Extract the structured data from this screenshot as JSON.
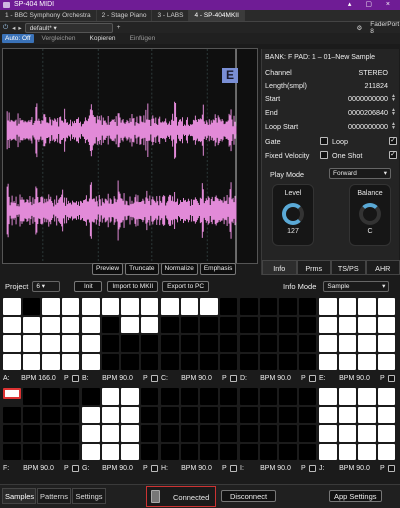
{
  "window": {
    "title": "SP-404 MIDI",
    "controls": "▴ ▢ ×"
  },
  "tabs": [
    {
      "label": "1 - BBC Symphony Orchestra",
      "active": false
    },
    {
      "label": "2 - Stage Piano",
      "active": false
    },
    {
      "label": "3 - LABS",
      "active": false
    },
    {
      "label": "4 - SP-404MKII",
      "active": true
    }
  ],
  "plugin_bar": {
    "preset": "default*",
    "controller": "FaderPort 8"
  },
  "toolbar": {
    "auto_off": "Auto: Off",
    "compare": "Vergleichen",
    "copy": "Kopieren",
    "paste": "Einfügen"
  },
  "wave": {
    "badge": "E",
    "buttons": [
      "Preview",
      "Truncate",
      "Normalize",
      "Emphasis"
    ]
  },
  "info": {
    "bank_pad": "BANK: F PAD: 1 – 01–New Sample",
    "rows": [
      {
        "label": "Channel",
        "value": "STEREO"
      },
      {
        "label": "Length(smpl)",
        "value": "211824"
      },
      {
        "label": "Start",
        "value": "0000000000"
      },
      {
        "label": "End",
        "value": "0000206840"
      },
      {
        "label": "Loop Start",
        "value": "0000000000"
      }
    ],
    "gate": "Gate",
    "loop": "Loop",
    "fixed_velocity": "Fixed Velocity",
    "one_shot": "One Shot",
    "play_mode_label": "Play Mode",
    "play_mode": "Forward",
    "level": {
      "label": "Level",
      "value": "127"
    },
    "balance": {
      "label": "Balance",
      "value": "C"
    },
    "tabs": [
      "Info",
      "Prms",
      "TS/PS",
      "AHR"
    ]
  },
  "project": {
    "label": "Project",
    "value": "6",
    "init": "Init",
    "import": "Import to MKII",
    "export": "Export to PC",
    "info_mode_label": "Info Mode",
    "info_mode": "Sample"
  },
  "pads": [
    {
      "letter": "A:",
      "bpm": "BPM 166.0",
      "p": "P",
      "cells": [
        1,
        0,
        1,
        1,
        1,
        1,
        1,
        1,
        1,
        1,
        1,
        1,
        1,
        1,
        1,
        1
      ]
    },
    {
      "letter": "B:",
      "bpm": "BPM 90.0",
      "p": "P",
      "cells": [
        1,
        1,
        1,
        1,
        1,
        0,
        1,
        1,
        1,
        0,
        0,
        0,
        1,
        0,
        0,
        0
      ]
    },
    {
      "letter": "C:",
      "bpm": "BPM 90.0",
      "p": "P",
      "cells": [
        1,
        1,
        1,
        0,
        0,
        0,
        0,
        0,
        0,
        0,
        0,
        0,
        0,
        0,
        0,
        0
      ]
    },
    {
      "letter": "D:",
      "bpm": "BPM 90.0",
      "p": "P",
      "cells": [
        0,
        0,
        0,
        0,
        0,
        0,
        0,
        0,
        0,
        0,
        0,
        0,
        0,
        0,
        0,
        0
      ]
    },
    {
      "letter": "E:",
      "bpm": "BPM 90.0",
      "p": "P",
      "cells": [
        1,
        1,
        1,
        1,
        1,
        1,
        1,
        1,
        1,
        1,
        1,
        1,
        1,
        1,
        1,
        1
      ]
    },
    {
      "letter": "F:",
      "bpm": "BPM 90.0",
      "p": "P",
      "cells": [
        2,
        0,
        0,
        0,
        0,
        0,
        0,
        0,
        0,
        0,
        0,
        0,
        0,
        0,
        0,
        0
      ]
    },
    {
      "letter": "G:",
      "bpm": "BPM 90.0",
      "p": "P",
      "cells": [
        0,
        1,
        1,
        0,
        1,
        1,
        1,
        0,
        1,
        1,
        1,
        0,
        1,
        1,
        1,
        0
      ]
    },
    {
      "letter": "H:",
      "bpm": "BPM 90.0",
      "p": "P",
      "cells": [
        0,
        0,
        0,
        0,
        0,
        0,
        0,
        0,
        0,
        0,
        0,
        0,
        0,
        0,
        0,
        0
      ]
    },
    {
      "letter": "I:",
      "bpm": "BPM 90.0",
      "p": "P",
      "cells": [
        0,
        0,
        0,
        0,
        0,
        0,
        0,
        0,
        0,
        0,
        0,
        0,
        0,
        0,
        0,
        0
      ]
    },
    {
      "letter": "J:",
      "bpm": "BPM 90.0",
      "p": "P",
      "cells": [
        1,
        1,
        1,
        1,
        1,
        1,
        1,
        1,
        1,
        1,
        1,
        1,
        1,
        1,
        1,
        1
      ]
    }
  ],
  "bottom": {
    "tabs": [
      "Samples",
      "Patterns",
      "Settings"
    ],
    "status": "Connected",
    "disconnect": "Disconnect",
    "app_settings": "App Settings"
  },
  "colors": {
    "accent": "#6f1c95",
    "wave": "#e28ad8",
    "knob": "#5aa9d6",
    "selected_pad": "#dd3333"
  }
}
